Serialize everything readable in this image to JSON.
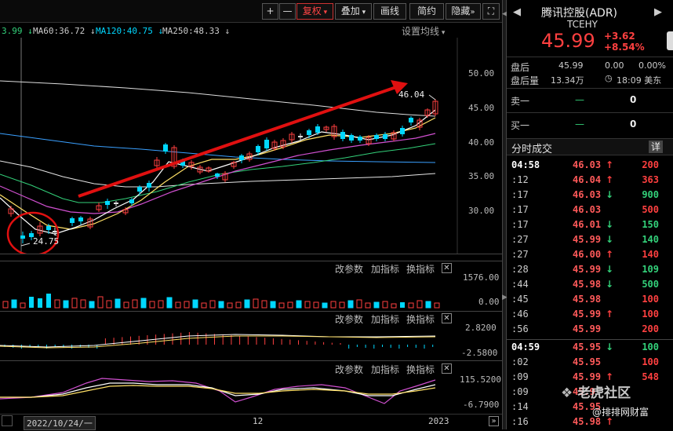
{
  "toolbar": {
    "plus": "+",
    "minus": "—",
    "fuquan": "复权",
    "diejia": "叠加",
    "huaxian": "画线",
    "jianyue": "简约",
    "yincang": "隐藏"
  },
  "ma": {
    "ma_partial": "3.99",
    "ma60": "MA60:36.72",
    "ma120": "MA120:40.75",
    "ma250": "MA250:48.33",
    "settings": "设置均线"
  },
  "price_axis": [
    "50.00",
    "45.00",
    "40.00",
    "35.00",
    "30.00"
  ],
  "annotations": {
    "high": "46.04",
    "low": "24.75"
  },
  "sub_panels": {
    "change_params": "改参数",
    "add_indicator": "加指标",
    "switch_indicator": "换指标",
    "vol_axis": [
      "1576.00",
      "0.00"
    ],
    "macd_axis": [
      "2.8200",
      "-2.5800"
    ],
    "kdj_axis": [
      "115.5200",
      "-6.7900"
    ]
  },
  "time_axis": {
    "start": "2022/10/24/一",
    "mid": "12",
    "end": "2023"
  },
  "stock": {
    "name": "腾讯控股(ADR)",
    "ticker": "TCEHY",
    "price": "45.99",
    "change": "+3.62",
    "change_pct": "+8.54%",
    "after_label": "盘后",
    "after_price": "45.99",
    "after_change": "0.00",
    "after_pct": "0.00%",
    "after_vol_label": "盘后量",
    "after_vol": "13.34万",
    "time": "18:09 美东",
    "sell1": "卖一",
    "sell1_val": "—",
    "sell1_vol": "0",
    "buy1": "买一",
    "buy1_val": "—",
    "buy1_vol": "0"
  },
  "ticks_header": {
    "title": "分时成交",
    "detail": "详"
  },
  "ticks": [
    {
      "t": "04:58",
      "p": "46.03",
      "d": "up",
      "v": "200",
      "bold": true
    },
    {
      "t": ":12",
      "p": "46.04",
      "d": "up",
      "v": "363"
    },
    {
      "t": ":17",
      "p": "46.03",
      "d": "down",
      "v": "900"
    },
    {
      "t": ":17",
      "p": "46.03",
      "d": "",
      "v": "500"
    },
    {
      "t": ":17",
      "p": "46.01",
      "d": "down",
      "v": "150"
    },
    {
      "t": ":27",
      "p": "45.99",
      "d": "down",
      "v": "140"
    },
    {
      "t": ":27",
      "p": "46.00",
      "d": "up",
      "v": "140"
    },
    {
      "t": ":28",
      "p": "45.99",
      "d": "down",
      "v": "109"
    },
    {
      "t": ":44",
      "p": "45.98",
      "d": "down",
      "v": "500"
    },
    {
      "t": ":45",
      "p": "45.98",
      "d": "",
      "v": "100"
    },
    {
      "t": ":46",
      "p": "45.99",
      "d": "up",
      "v": "100"
    },
    {
      "t": ":56",
      "p": "45.99",
      "d": "",
      "v": "200"
    },
    {
      "t": "04:59",
      "p": "45.95",
      "d": "down",
      "v": "100",
      "bold": true
    },
    {
      "t": ":02",
      "p": "45.95",
      "d": "",
      "v": "100"
    },
    {
      "t": ":09",
      "p": "45.99",
      "d": "up",
      "v": "548"
    },
    {
      "t": ":09",
      "p": "45.9",
      "d": "",
      "v": ""
    },
    {
      "t": ":14",
      "p": "45.95",
      "d": "",
      "v": ""
    },
    {
      "t": ":16",
      "p": "45.98",
      "d": "up",
      "v": ""
    }
  ],
  "watermark": {
    "tiger": "老虎社区",
    "source": "@排排网财富"
  },
  "colors": {
    "up": "#ff4040",
    "down": "#33d17a",
    "cyan": "#00d7ff"
  }
}
